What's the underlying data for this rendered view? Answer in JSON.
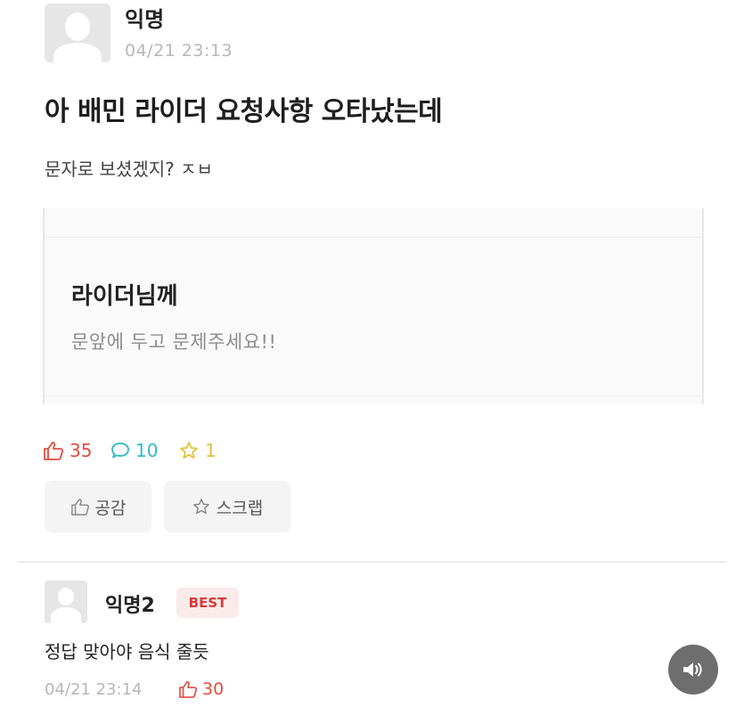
{
  "post": {
    "author": "익명",
    "time": "04/21 23:13",
    "title": "아 배민 라이더 요청사항 오타났는데",
    "body": "문자로 보셨겠지? ㅈㅂ"
  },
  "card": {
    "title": "라이더님께",
    "body": "문앞에 두고 문제주세요!!"
  },
  "stats": {
    "likes": "35",
    "comments": "10",
    "scraps": "1"
  },
  "actions": {
    "like_label": "공감",
    "scrap_label": "스크랩"
  },
  "comment": {
    "author": "익명2",
    "badge": "BEST",
    "text": "정답 맞아야 음식 줄듯",
    "time": "04/21 23:14",
    "likes": "30"
  },
  "colors": {
    "like": "#e24c3f",
    "comment": "#2db9c8",
    "scrap": "#e3c23a",
    "best_bg": "#fbeaea",
    "best_text": "#d8393a"
  },
  "icons": [
    "thumbs-up-icon",
    "speech-bubble-icon",
    "star-icon",
    "volume-icon"
  ]
}
